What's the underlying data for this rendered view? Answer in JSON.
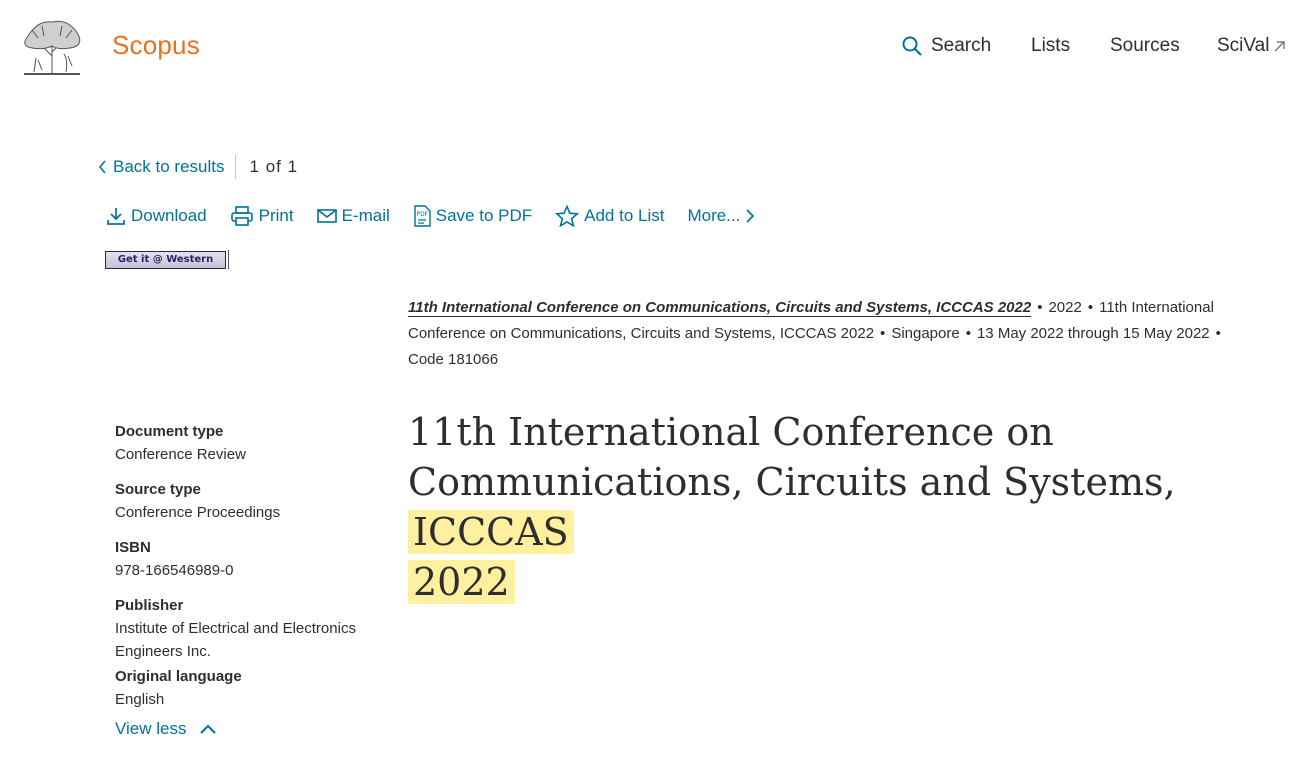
{
  "header": {
    "brand": "Scopus",
    "nav": {
      "search": "Search",
      "lists": "Lists",
      "sources": "Sources",
      "scival": "SciVal"
    }
  },
  "back": {
    "label": "Back to results",
    "current": "1",
    "of": "of",
    "total": "1"
  },
  "toolbar": {
    "download": "Download",
    "print": "Print",
    "email": "E-mail",
    "save_pdf": "Save to PDF",
    "add_list": "Add to List",
    "more": "More..."
  },
  "getit": {
    "label": "Get it @ Western"
  },
  "source": {
    "link": "11th International Conference on Communications, Circuits and Systems, ICCCAS 2022",
    "year": "2022",
    "conference": "11th International Conference on Communications, Circuits and Systems, ICCCAS 2022",
    "location": "Singapore",
    "dates": "13 May 2022 through 15 May 2022",
    "code": "Code 181066"
  },
  "title": {
    "plain": "11th International Conference on Communications, Circuits and Systems,",
    "highlight_1": "ICCCAS",
    "highlight_2": "2022"
  },
  "meta": {
    "doc_type_label": "Document type",
    "doc_type_value": "Conference Review",
    "source_type_label": "Source type",
    "source_type_value": "Conference Proceedings",
    "isbn_label": "ISBN",
    "isbn_value": "978-166546989-0",
    "publisher_label": "Publisher",
    "publisher_value": "Institute of Electrical and Electronics Engineers Inc.",
    "language_label": "Original language",
    "language_value": "English"
  },
  "view_less": "View less",
  "colors": {
    "brand": "#e9711c",
    "link": "#007398",
    "highlight": "#fff0a0",
    "text": "#2e2e2e"
  }
}
